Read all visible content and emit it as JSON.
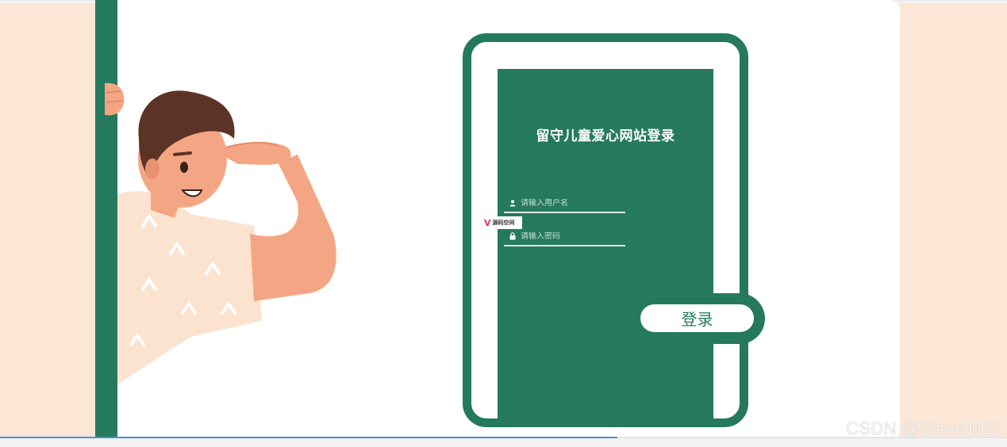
{
  "login": {
    "title": "留守儿童爱心网站登录",
    "username_placeholder": "请输入用户名",
    "password_placeholder": "请输入密码",
    "submit_label": "登录"
  },
  "watermark": {
    "site_logo_text": "源码空间",
    "csdn_text": "CSDN @Steve1122"
  },
  "icons": {
    "username": "user-icon",
    "password": "lock-icon"
  },
  "colors": {
    "brand_green": "#257a5e",
    "page_background": "#fce7d6",
    "card_background": "#ffffff"
  }
}
